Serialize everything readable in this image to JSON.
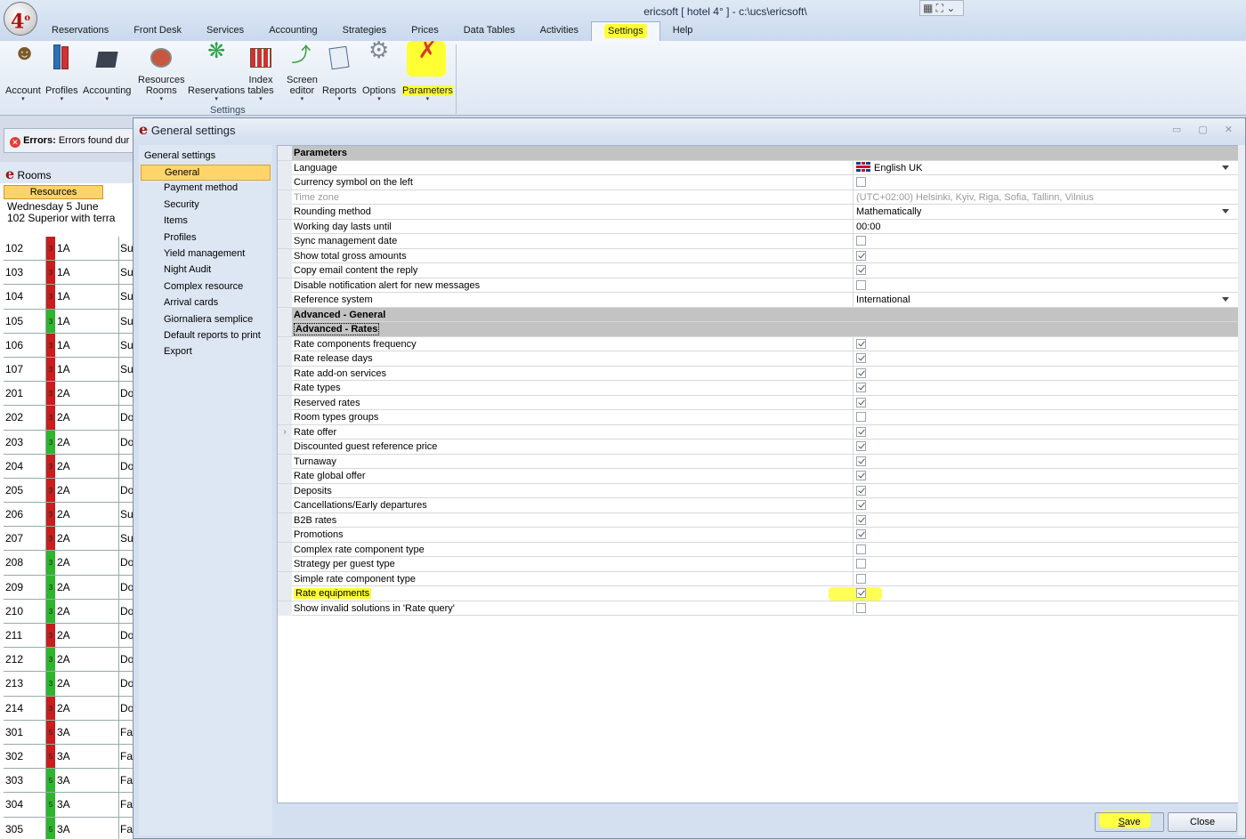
{
  "window": {
    "title": "ericsoft [ hotel 4° ] - c:\\ucs\\ericsoft\\",
    "logo_text": "4",
    "logo_sup": "o",
    "title_tools": "▦ ⛶ ⌄"
  },
  "menu": [
    {
      "label": "Reservations"
    },
    {
      "label": "Front Desk"
    },
    {
      "label": "Services"
    },
    {
      "label": "Accounting"
    },
    {
      "label": "Strategies"
    },
    {
      "label": "Prices"
    },
    {
      "label": "Data Tables"
    },
    {
      "label": "Activities"
    },
    {
      "label": "Settings",
      "active": true
    },
    {
      "label": "Help"
    }
  ],
  "ribbon": {
    "group_label": "Settings",
    "buttons": [
      {
        "line1": "Account",
        "line2": "",
        "dropdown": true,
        "icon": "account-icon"
      },
      {
        "line1": "Profiles",
        "line2": "",
        "dropdown": true,
        "icon": "profiles-icon"
      },
      {
        "line1": "Accounting",
        "line2": "",
        "dropdown": true,
        "icon": "accounting-icon"
      },
      {
        "line1": "Resources",
        "line2": "Rooms",
        "dropdown": true,
        "icon": "resources-icon"
      },
      {
        "line1": "Reservations",
        "line2": "",
        "dropdown": true,
        "icon": "reservations-icon"
      },
      {
        "line1": "Index",
        "line2": "tables",
        "dropdown": true,
        "icon": "index-tables-icon"
      },
      {
        "line1": "Screen",
        "line2": "editor",
        "dropdown": true,
        "icon": "screen-editor-icon"
      },
      {
        "line1": "Reports",
        "line2": "",
        "dropdown": true,
        "icon": "reports-icon"
      },
      {
        "line1": "Options",
        "line2": "",
        "dropdown": true,
        "icon": "options-icon"
      },
      {
        "line1": "Parameters",
        "line2": "",
        "dropdown": true,
        "icon": "parameters-icon"
      }
    ]
  },
  "errors_bar": {
    "label": "Errors:",
    "text": "Errors found dur"
  },
  "rooms_panel": {
    "title": "Rooms",
    "tab": "Resources",
    "date": "Wednesday 5 June",
    "subtitle": "102 Superior with terra",
    "rows": [
      {
        "num": "102",
        "status": "3",
        "color": "#c81e1e",
        "type": "1A",
        "desc": "Su"
      },
      {
        "num": "103",
        "status": "3",
        "color": "#c81e1e",
        "type": "1A",
        "desc": "Su"
      },
      {
        "num": "104",
        "status": "3",
        "color": "#c81e1e",
        "type": "1A",
        "desc": "Su"
      },
      {
        "num": "105",
        "status": "3",
        "color": "#2db52d",
        "type": "1A",
        "desc": "Su"
      },
      {
        "num": "106",
        "status": "3",
        "color": "#c81e1e",
        "type": "1A",
        "desc": "Su"
      },
      {
        "num": "107",
        "status": "3",
        "color": "#c81e1e",
        "type": "1A",
        "desc": "Su"
      },
      {
        "num": "201",
        "status": "3",
        "color": "#c81e1e",
        "type": "2A",
        "desc": "Do"
      },
      {
        "num": "202",
        "status": "3",
        "color": "#c81e1e",
        "type": "2A",
        "desc": "Do"
      },
      {
        "num": "203",
        "status": "3",
        "color": "#2db52d",
        "type": "2A",
        "desc": "Do"
      },
      {
        "num": "204",
        "status": "3",
        "color": "#c81e1e",
        "type": "2A",
        "desc": "Do"
      },
      {
        "num": "205",
        "status": "3",
        "color": "#c81e1e",
        "type": "2A",
        "desc": "Do"
      },
      {
        "num": "206",
        "status": "3",
        "color": "#c81e1e",
        "type": "2A",
        "desc": "Su"
      },
      {
        "num": "207",
        "status": "3",
        "color": "#c81e1e",
        "type": "2A",
        "desc": "Su"
      },
      {
        "num": "208",
        "status": "3",
        "color": "#2db52d",
        "type": "2A",
        "desc": "Do"
      },
      {
        "num": "209",
        "status": "3",
        "color": "#2db52d",
        "type": "2A",
        "desc": "Do"
      },
      {
        "num": "210",
        "status": "3",
        "color": "#2db52d",
        "type": "2A",
        "desc": "Do"
      },
      {
        "num": "211",
        "status": "3",
        "color": "#c81e1e",
        "type": "2A",
        "desc": "Do"
      },
      {
        "num": "212",
        "status": "3",
        "color": "#2db52d",
        "type": "2A",
        "desc": "Do"
      },
      {
        "num": "213",
        "status": "3",
        "color": "#2db52d",
        "type": "2A",
        "desc": "Do"
      },
      {
        "num": "214",
        "status": "3",
        "color": "#c81e1e",
        "type": "2A",
        "desc": "Do"
      },
      {
        "num": "301",
        "status": "5",
        "color": "#c81e1e",
        "type": "3A",
        "desc": "Fa"
      },
      {
        "num": "302",
        "status": "5",
        "color": "#c81e1e",
        "type": "3A",
        "desc": "Fa"
      },
      {
        "num": "303",
        "status": "5",
        "color": "#2db52d",
        "type": "3A",
        "desc": "Fa"
      },
      {
        "num": "304",
        "status": "5",
        "color": "#2db52d",
        "type": "3A",
        "desc": "Fa"
      },
      {
        "num": "305",
        "status": "5",
        "color": "#2db52d",
        "type": "3A",
        "desc": "Fa"
      }
    ]
  },
  "dialog": {
    "title": "General settings",
    "controls": "▭ ▢ ✕",
    "nav_title": "General settings",
    "nav_items": [
      {
        "label": "General",
        "selected": true
      },
      {
        "label": "Payment method"
      },
      {
        "label": "Security"
      },
      {
        "label": "Items"
      },
      {
        "label": "Profiles"
      },
      {
        "label": "Yield management"
      },
      {
        "label": "Night Audit"
      },
      {
        "label": "Complex resource"
      },
      {
        "label": "Arrival cards"
      },
      {
        "label": "Giornaliera semplice"
      },
      {
        "label": "Default reports to print"
      },
      {
        "label": "Export"
      }
    ],
    "rows": [
      {
        "kind": "section",
        "name": "Parameters"
      },
      {
        "kind": "dropdown",
        "name": "Language",
        "value": "English UK",
        "flag": true
      },
      {
        "kind": "check",
        "name": "Currency symbol on the left",
        "checked": false
      },
      {
        "kind": "text",
        "name": "Time zone",
        "value": "(UTC+02:00) Helsinki, Kyiv, Riga, Sofia, Tallinn, Vilnius",
        "disabled": true
      },
      {
        "kind": "dropdown",
        "name": "Rounding method",
        "value": "Mathematically"
      },
      {
        "kind": "text",
        "name": "Working day lasts until",
        "value": "00:00"
      },
      {
        "kind": "check",
        "name": "Sync management date",
        "checked": false
      },
      {
        "kind": "check",
        "name": "Show total gross amounts",
        "checked": true
      },
      {
        "kind": "check",
        "name": "Copy email content the reply",
        "checked": true
      },
      {
        "kind": "check",
        "name": "Disable notification alert for new messages",
        "checked": false
      },
      {
        "kind": "dropdown",
        "name": "Reference system",
        "value": "International"
      },
      {
        "kind": "section",
        "name": "Advanced - General"
      },
      {
        "kind": "section",
        "name": "Advanced - Rates",
        "boxed": true
      },
      {
        "kind": "check",
        "name": "Rate components frequency",
        "checked": true
      },
      {
        "kind": "check",
        "name": "Rate release days",
        "checked": true
      },
      {
        "kind": "check",
        "name": "Rate add-on services",
        "checked": true
      },
      {
        "kind": "check",
        "name": "Rate types",
        "checked": true
      },
      {
        "kind": "check",
        "name": "Reserved rates",
        "checked": true
      },
      {
        "kind": "check",
        "name": "Room types groups",
        "checked": false
      },
      {
        "kind": "check",
        "name": "Rate offer",
        "checked": true,
        "marker": true
      },
      {
        "kind": "check",
        "name": "Discounted guest reference price",
        "checked": true
      },
      {
        "kind": "check",
        "name": "Turnaway",
        "checked": true
      },
      {
        "kind": "check",
        "name": "Rate global offer",
        "checked": true
      },
      {
        "kind": "check",
        "name": "Deposits",
        "checked": true
      },
      {
        "kind": "check",
        "name": "Cancellations/Early departures",
        "checked": true
      },
      {
        "kind": "check",
        "name": "B2B rates",
        "checked": true
      },
      {
        "kind": "check",
        "name": "Promotions",
        "checked": true
      },
      {
        "kind": "check",
        "name": "Complex rate component type",
        "checked": false
      },
      {
        "kind": "check",
        "name": "Strategy per guest type",
        "checked": false
      },
      {
        "kind": "check",
        "name": "Simple rate component type",
        "checked": false
      },
      {
        "kind": "check",
        "name": "Rate equipments",
        "checked": true,
        "highlight": true
      },
      {
        "kind": "check",
        "name": "Show invalid solutions in 'Rate query'",
        "checked": false
      }
    ],
    "save_label": "Save",
    "close_label": "Close"
  },
  "colors": {
    "highlight": "#ffff33",
    "selection": "#ffd56a",
    "room_red": "#c81e1e",
    "room_green": "#2db52d"
  }
}
